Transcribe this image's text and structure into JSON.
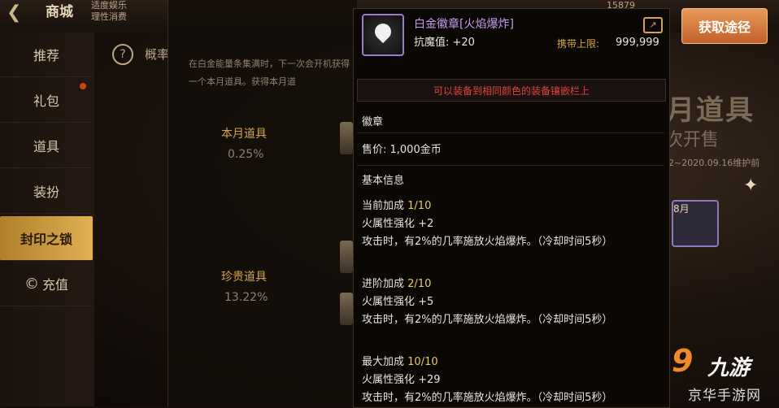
{
  "topbar": {
    "title": "商城",
    "hint_line1": "适度娱乐",
    "hint_line2": "理性消费",
    "coin_text": "15879"
  },
  "sidebar": {
    "items": [
      {
        "label": "推荐"
      },
      {
        "label": "礼包"
      },
      {
        "label": "道具"
      },
      {
        "label": "装扮"
      },
      {
        "label": "封印之锁"
      },
      {
        "label": "充值"
      }
    ]
  },
  "panel": {
    "overview": "概率",
    "description": "在白金能量条集满时，下一次会开机获得一个本月道具。获得本月道",
    "categories": [
      {
        "name": "本月道具",
        "rate": "0.25%"
      },
      {
        "name": "珍贵道具",
        "rate": "13.22%"
      }
    ]
  },
  "banner": {
    "title": "月道具",
    "subtitle": "次开售",
    "date": "2~2020.09.16维护前",
    "item_badge": "8月"
  },
  "get_button": "获取途径",
  "tooltip": {
    "name": "白金徽章[火焰爆炸]",
    "stat": "抗魔值: +20",
    "limit_label": "携带上限:",
    "limit_value": "999,999",
    "note": "可以装备到相同颜色的装备镶嵌栏上",
    "type": "徽章",
    "price": "售价: 1,000金币",
    "section_title": "基本信息",
    "bonuses": [
      {
        "title": "当前加成",
        "level": "1/10",
        "line1": "火属性强化 +2",
        "line2": "攻击时，有2%的几率施放火焰爆炸。（冷却时间5秒）"
      },
      {
        "title": "进阶加成",
        "level": "2/10",
        "line1": "火属性强化 +5",
        "line2": "攻击时，有2%的几率施放火焰爆炸。（冷却时间5秒）"
      },
      {
        "title": "最大加成",
        "level": "10/10",
        "line1": "火属性强化 +29",
        "line2": "攻击时，有2%的几率施放火焰爆炸。（冷却时间5秒）"
      }
    ]
  },
  "watermark": {
    "logo": "九游",
    "site": "京华手游网"
  }
}
